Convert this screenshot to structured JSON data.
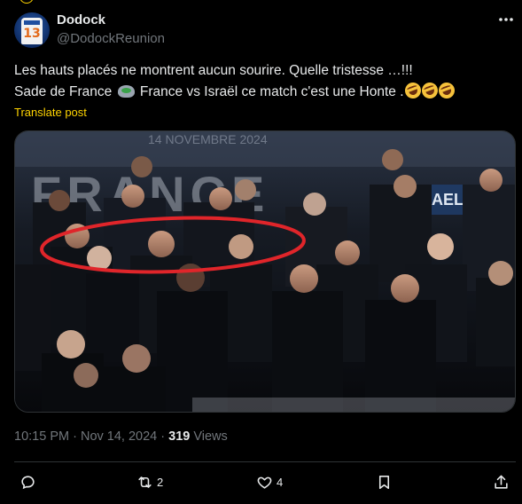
{
  "post": {
    "author_name": "Dodock",
    "author_handle": "@DodockReunion",
    "avatar_number": "13",
    "text_line1": "Les hauts placés ne montrent aucun sourire. Quelle tristesse …!!!",
    "text_line2a": "Sade de France",
    "text_line2b": "France vs Israël ce match c'est une Honte .",
    "translate_label": "Translate post",
    "time": "10:15 PM",
    "separator": " · ",
    "date": "Nov 14, 2024",
    "views_count": "319",
    "views_label": " Views"
  },
  "media": {
    "banner_date": "14 NOVEMBRE 2024",
    "banner_word": "FRANCE",
    "banner_right": "AEL"
  },
  "actions": {
    "reply_count": "",
    "repost_count": "2",
    "like_count": "4"
  },
  "icons": {
    "more": "more-icon",
    "reply": "reply-icon",
    "repost": "repost-icon",
    "like": "like-icon",
    "bookmark": "bookmark-icon",
    "share": "share-icon"
  },
  "colors": {
    "background": "#000000",
    "text": "#e7e9ea",
    "muted": "#71767b",
    "accent": "#ffd400",
    "annotation": "#e0252a"
  }
}
